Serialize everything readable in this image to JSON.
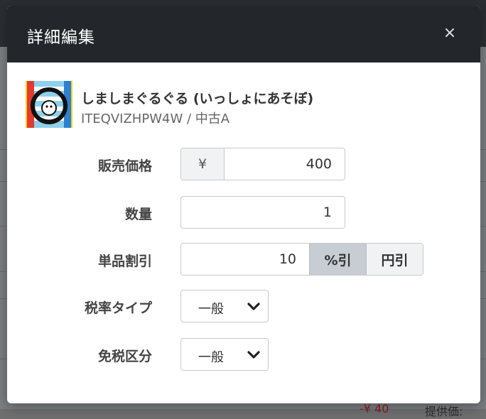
{
  "modal": {
    "title": "詳細編集",
    "close": "×"
  },
  "product": {
    "name": "しましまぐるぐる (いっしょにあそぼ)",
    "sub": "ITEQVIZHPW4W / 中古A"
  },
  "form": {
    "price": {
      "label": "販売価格",
      "currency": "¥",
      "value": "400"
    },
    "quantity": {
      "label": "数量",
      "value": "1"
    },
    "discount": {
      "label": "単品割引",
      "value": "10",
      "percent_option": "%引",
      "yen_option": "円引",
      "selected": "%引"
    },
    "tax_type": {
      "label": "税率タイプ",
      "value": "一般"
    },
    "tax_exempt": {
      "label": "免税区分",
      "value": "一般"
    }
  },
  "background": {
    "bottom_text_1": "-¥ 40",
    "bottom_text_2": "提供価:"
  },
  "colors": {
    "header_bg": "#23272b",
    "selected_segment": "#c8cdd3",
    "addon_bg": "#f1f2f3"
  }
}
